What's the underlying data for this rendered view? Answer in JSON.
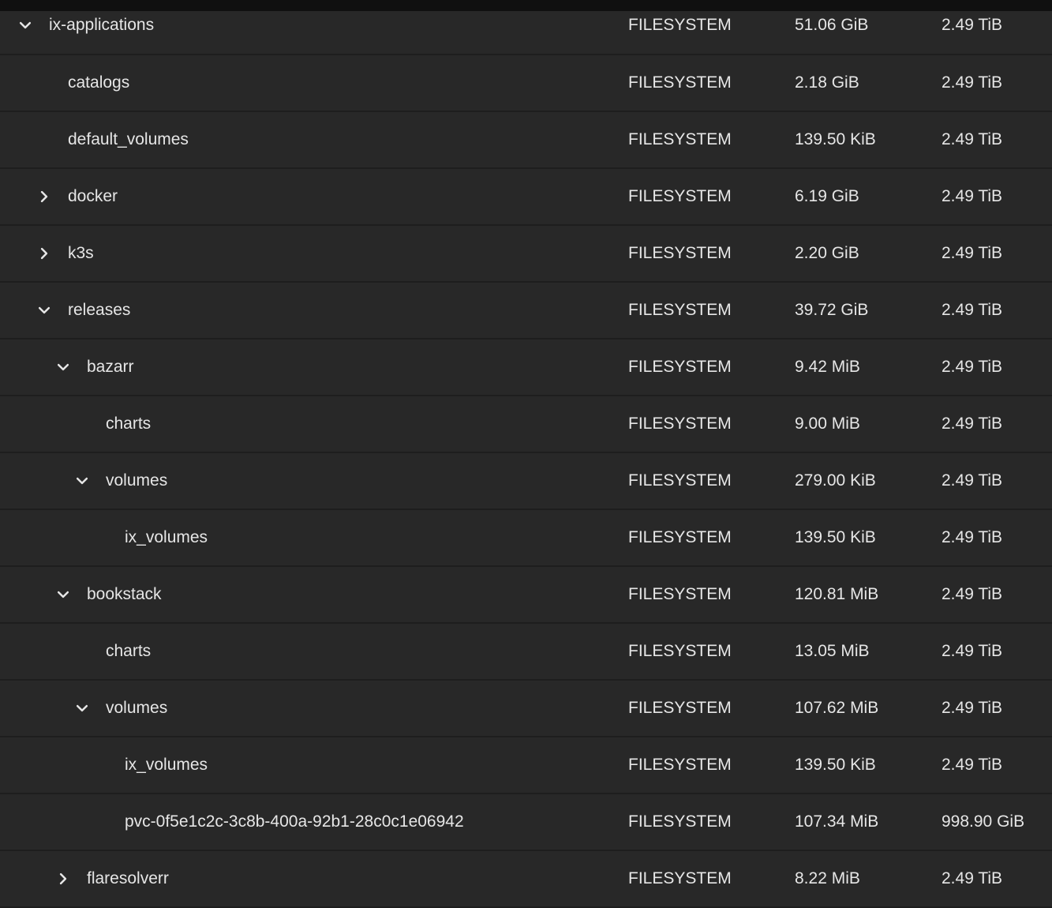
{
  "rows": [
    {
      "name": "ix-applications",
      "depth": 0,
      "toggle": "expanded",
      "type": "FILESYSTEM",
      "used": "51.06 GiB",
      "available": "2.49 TiB"
    },
    {
      "name": "catalogs",
      "depth": 1,
      "toggle": "none",
      "type": "FILESYSTEM",
      "used": "2.18 GiB",
      "available": "2.49 TiB"
    },
    {
      "name": "default_volumes",
      "depth": 1,
      "toggle": "none",
      "type": "FILESYSTEM",
      "used": "139.50 KiB",
      "available": "2.49 TiB"
    },
    {
      "name": "docker",
      "depth": 1,
      "toggle": "collapsed",
      "type": "FILESYSTEM",
      "used": "6.19 GiB",
      "available": "2.49 TiB"
    },
    {
      "name": "k3s",
      "depth": 1,
      "toggle": "collapsed",
      "type": "FILESYSTEM",
      "used": "2.20 GiB",
      "available": "2.49 TiB"
    },
    {
      "name": "releases",
      "depth": 1,
      "toggle": "expanded",
      "type": "FILESYSTEM",
      "used": "39.72 GiB",
      "available": "2.49 TiB"
    },
    {
      "name": "bazarr",
      "depth": 2,
      "toggle": "expanded",
      "type": "FILESYSTEM",
      "used": "9.42 MiB",
      "available": "2.49 TiB"
    },
    {
      "name": "charts",
      "depth": 3,
      "toggle": "none",
      "type": "FILESYSTEM",
      "used": "9.00 MiB",
      "available": "2.49 TiB"
    },
    {
      "name": "volumes",
      "depth": 3,
      "toggle": "expanded",
      "type": "FILESYSTEM",
      "used": "279.00 KiB",
      "available": "2.49 TiB"
    },
    {
      "name": "ix_volumes",
      "depth": 4,
      "toggle": "none",
      "type": "FILESYSTEM",
      "used": "139.50 KiB",
      "available": "2.49 TiB"
    },
    {
      "name": "bookstack",
      "depth": 2,
      "toggle": "expanded",
      "type": "FILESYSTEM",
      "used": "120.81 MiB",
      "available": "2.49 TiB"
    },
    {
      "name": "charts",
      "depth": 3,
      "toggle": "none",
      "type": "FILESYSTEM",
      "used": "13.05 MiB",
      "available": "2.49 TiB"
    },
    {
      "name": "volumes",
      "depth": 3,
      "toggle": "expanded",
      "type": "FILESYSTEM",
      "used": "107.62 MiB",
      "available": "2.49 TiB"
    },
    {
      "name": "ix_volumes",
      "depth": 4,
      "toggle": "none",
      "type": "FILESYSTEM",
      "used": "139.50 KiB",
      "available": "2.49 TiB"
    },
    {
      "name": "pvc-0f5e1c2c-3c8b-400a-92b1-28c0c1e06942",
      "depth": 4,
      "toggle": "none",
      "type": "FILESYSTEM",
      "used": "107.34 MiB",
      "available": "998.90 GiB"
    },
    {
      "name": "flaresolverr",
      "depth": 2,
      "toggle": "collapsed",
      "type": "FILESYSTEM",
      "used": "8.22 MiB",
      "available": "2.49 TiB"
    }
  ]
}
